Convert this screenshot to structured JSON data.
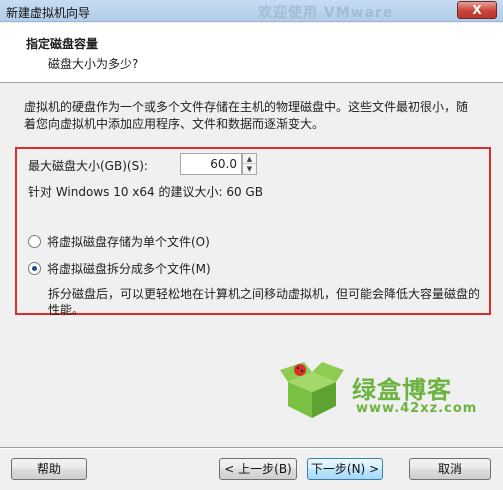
{
  "window": {
    "title": "新建虚拟机向导",
    "background_brand": "欢迎使用 VMware",
    "close_label": "X"
  },
  "header": {
    "title": "指定磁盘容量",
    "subtitle": "磁盘大小为多少?"
  },
  "description": "虚拟机的硬盘作为一个或多个文件存储在主机的物理磁盘中。这些文件最初很小，随着您向虚拟机中添加应用程序、文件和数据而逐渐变大。",
  "disk": {
    "max_size_label": "最大磁盘大小(GB)(S):",
    "max_size_value": "60.0",
    "recommendation": "针对 Windows 10 x64 的建议大小: 60 GB"
  },
  "storage_options": [
    {
      "label": "将虚拟磁盘存储为单个文件(O)",
      "selected": false
    },
    {
      "label": "将虚拟磁盘拆分成多个文件(M)",
      "selected": true
    }
  ],
  "split_description": "拆分磁盘后，可以更轻松地在计算机之间移动虚拟机，但可能会降低大容量磁盘的性能。",
  "watermark": {
    "title": "绿盒博客",
    "url": "www.42xz.com"
  },
  "buttons": {
    "help": "帮助",
    "back": "< 上一步(B)",
    "next": "下一步(N) >",
    "cancel": "取消"
  },
  "colors": {
    "highlight_border": "#e02b2b",
    "watermark_green": "#6cb33f"
  }
}
